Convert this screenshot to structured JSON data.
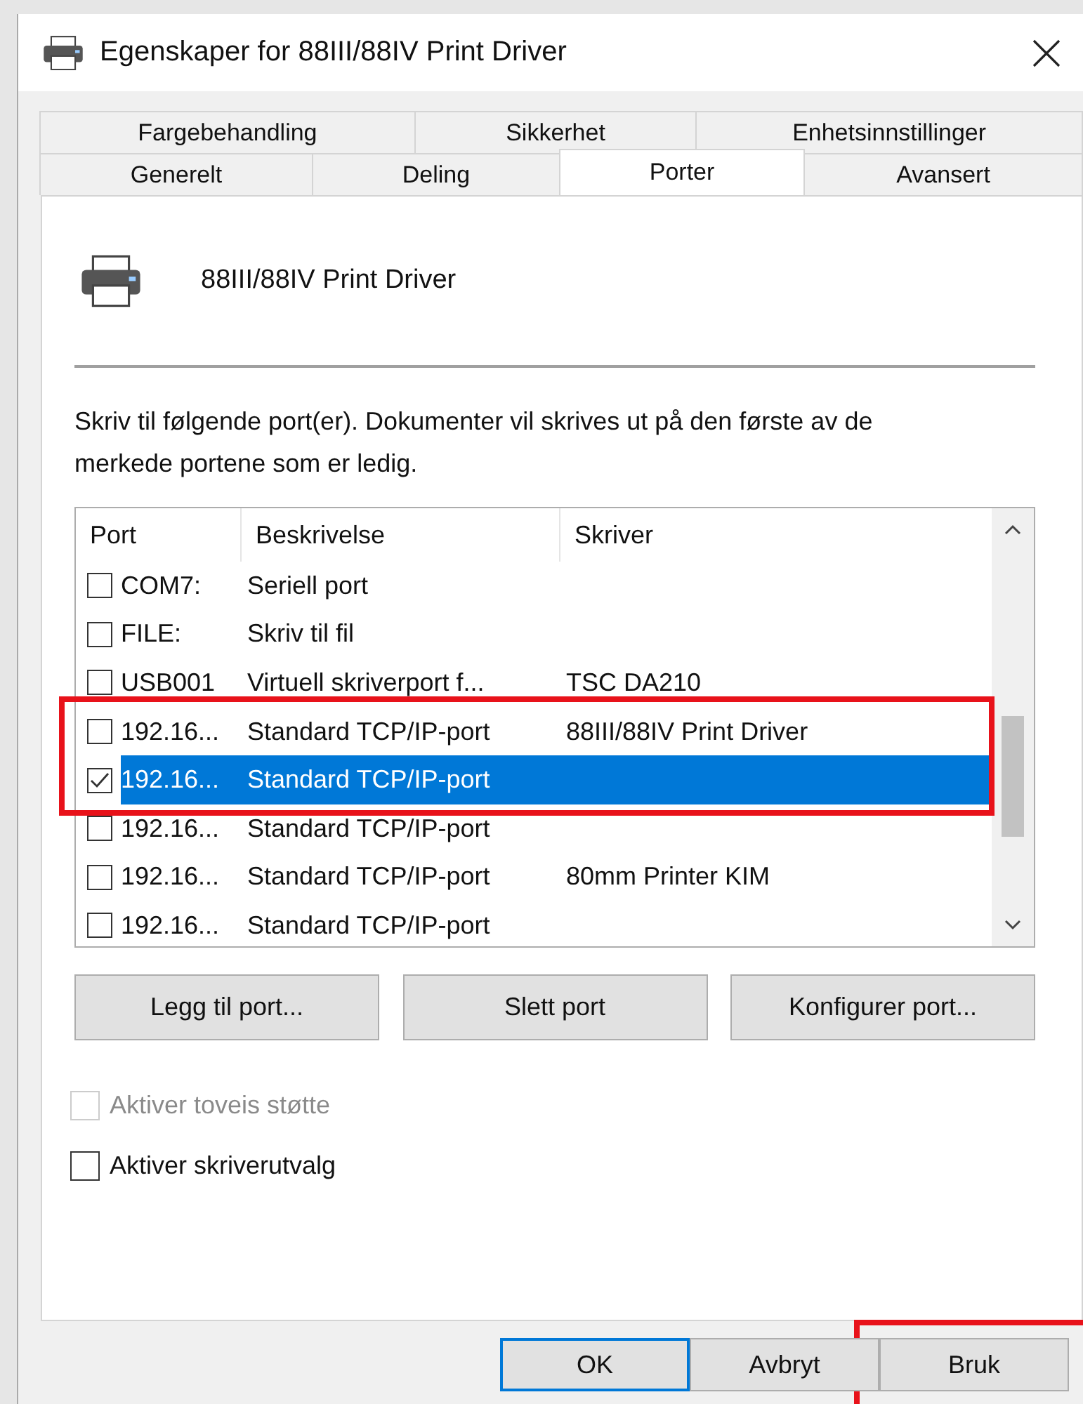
{
  "window": {
    "title": "Egenskaper for 88III/88IV Print Driver"
  },
  "tab_rows": [
    [
      {
        "label": "Fargebehandling",
        "selected": false
      },
      {
        "label": "Sikkerhet",
        "selected": false
      },
      {
        "label": "Enhetsinnstillinger",
        "selected": false
      }
    ],
    [
      {
        "label": "Generelt",
        "selected": false
      },
      {
        "label": "Deling",
        "selected": false
      },
      {
        "label": "Porter",
        "selected": true
      },
      {
        "label": "Avansert",
        "selected": false
      }
    ]
  ],
  "printer": {
    "name": "88III/88IV Print Driver"
  },
  "description": "Skriv til følgende port(er). Dokumenter vil skrives ut på den første av de merkede portene som er ledig.",
  "ports": {
    "columns": [
      "Port",
      "Beskrivelse",
      "Skriver"
    ],
    "rows": [
      {
        "cells": [
          "COM7:",
          "Seriell port",
          ""
        ],
        "checked": false,
        "selected": false,
        "marked": false
      },
      {
        "cells": [
          "FILE:",
          "Skriv til fil",
          ""
        ],
        "checked": false,
        "selected": false,
        "marked": false
      },
      {
        "cells": [
          "USB001",
          "Virtuell skriverport f...",
          "TSC DA210"
        ],
        "checked": false,
        "selected": false,
        "marked": false
      },
      {
        "cells": [
          "192.16...",
          "Standard TCP/IP-port",
          "88III/88IV Print Driver"
        ],
        "checked": false,
        "selected": false,
        "marked": true
      },
      {
        "cells": [
          "192.16...",
          "Standard TCP/IP-port",
          ""
        ],
        "checked": true,
        "selected": true,
        "marked": true
      },
      {
        "cells": [
          "192.16...",
          "Standard TCP/IP-port",
          ""
        ],
        "checked": false,
        "selected": false,
        "marked": false
      },
      {
        "cells": [
          "192.16...",
          "Standard TCP/IP-port",
          "80mm Printer KIM"
        ],
        "checked": false,
        "selected": false,
        "marked": false
      },
      {
        "cells": [
          "192.16...",
          "Standard TCP/IP-port",
          ""
        ],
        "checked": false,
        "selected": false,
        "marked": false
      }
    ]
  },
  "port_buttons": [
    "Legg til port...",
    "Slett port",
    "Konfigurer port..."
  ],
  "options": [
    {
      "label": "Aktiver toveis støtte",
      "checked": false,
      "disabled": true
    },
    {
      "label": "Aktiver skriverutvalg",
      "checked": false,
      "disabled": false
    }
  ],
  "dialog_buttons": [
    {
      "label": "OK",
      "default": true,
      "marked": false
    },
    {
      "label": "Avbryt",
      "default": false,
      "marked": false
    },
    {
      "label": "Bruk",
      "default": false,
      "marked": true
    }
  ]
}
